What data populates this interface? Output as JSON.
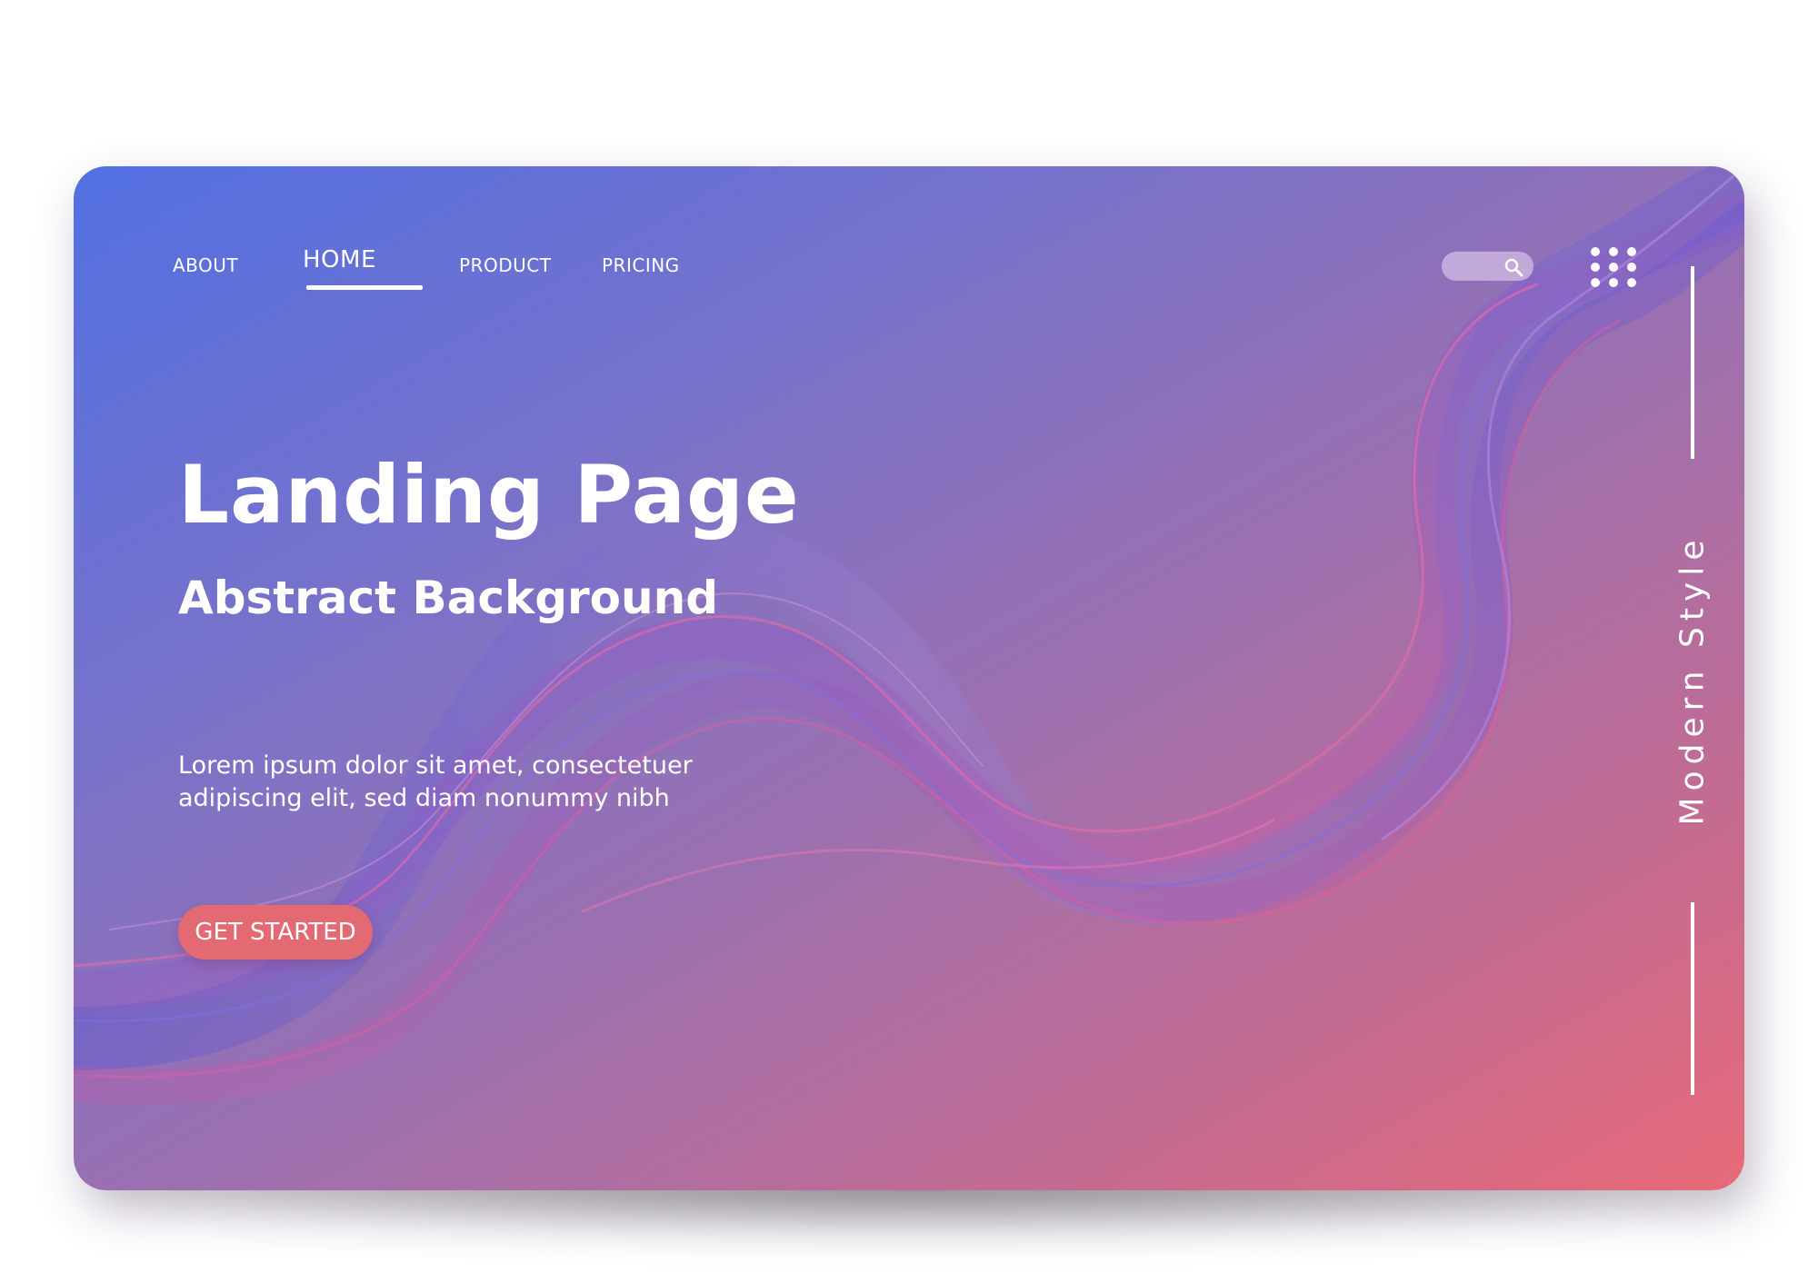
{
  "nav": {
    "about": "ABOUT",
    "home": "HOME",
    "product": "PRODUCT",
    "pricing": "PRICING"
  },
  "header": {
    "search_icon": "search-icon",
    "menu_icon": "grid-menu-icon"
  },
  "hero": {
    "title": "Landing Page",
    "subtitle": "Abstract Background",
    "body_line1": "Lorem ipsum dolor sit amet, consectetuer",
    "body_line2": "adipiscing elit, sed diam nonummy nibh",
    "cta_label": "GET STARTED"
  },
  "side": {
    "label": "Modern Style"
  },
  "colors": {
    "gradient_start": "#5270e2",
    "gradient_end": "#e76a78",
    "cta_background": "#e36a73",
    "text": "#ffffff"
  }
}
